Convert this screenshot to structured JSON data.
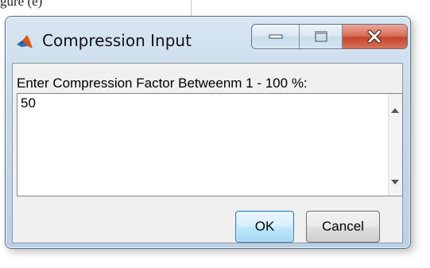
{
  "page": {
    "background_text": "gure (e)"
  },
  "window": {
    "title": "Compression Input",
    "icon": "matlab-icon",
    "controls": [
      "minimize-icon",
      "maximize-icon",
      "close-icon"
    ],
    "close_color": "#c4462c"
  },
  "dialog": {
    "prompt": "Enter Compression Factor Betweenm 1 - 100 %:",
    "input_value": "50",
    "buttons": {
      "ok": "OK",
      "cancel": "Cancel"
    },
    "ok_accent": "#3c7fb1"
  }
}
